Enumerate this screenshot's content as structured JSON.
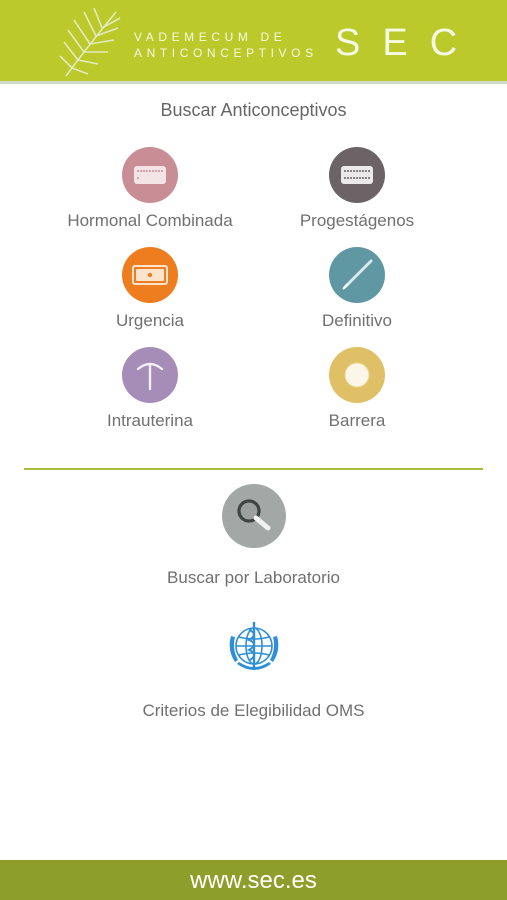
{
  "header": {
    "line1": "VADEMECUM DE",
    "line2": "ANTICONCEPTIVOS",
    "brand": "SEC",
    "colors": {
      "header_bg": "#bcc92a",
      "footer_bg": "#8d9e2b"
    }
  },
  "search": {
    "title": "Buscar Anticonceptivos"
  },
  "categories": [
    {
      "label": "Hormonal Combinada",
      "icon": "pill-pack-icon",
      "color": "#c98e95"
    },
    {
      "label": "Progestágenos",
      "icon": "pill-pack-icon",
      "color": "#6b6366"
    },
    {
      "label": "Urgencia",
      "icon": "emergency-pill-icon",
      "color": "#ee7d1f"
    },
    {
      "label": "Definitivo",
      "icon": "surgical-instrument-icon",
      "color": "#5f97a2"
    },
    {
      "label": "Intrauterina",
      "icon": "iud-icon",
      "color": "#a68db8"
    },
    {
      "label": "Barrera",
      "icon": "barrier-ring-icon",
      "color": "#e0c067"
    }
  ],
  "laboratory": {
    "label": "Buscar por Laboratorio",
    "icon": "magnifier-icon"
  },
  "oms": {
    "label": "Criterios de Elegibilidad OMS",
    "icon": "who-logo-icon"
  },
  "footer": {
    "url": "www.sec.es"
  }
}
